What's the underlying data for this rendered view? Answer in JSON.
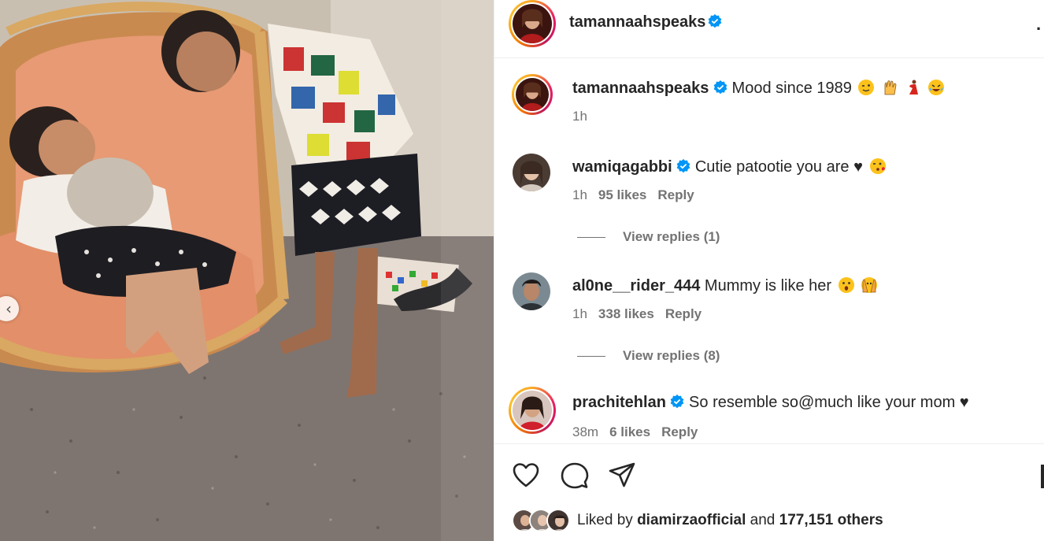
{
  "post": {
    "author": "tamannaahspeaks",
    "caption": {
      "username": "tamannaahspeaks",
      "text": "Mood since 1989",
      "time": "1h",
      "emojis": [
        "winking-face-icon",
        "raised-hands-icon",
        "dancer-icon",
        "rofl-face-icon"
      ]
    }
  },
  "comments": [
    {
      "username": "wamiqagabbi",
      "verified": true,
      "text": "Cutie patootie you are ♥",
      "time": "1h",
      "likes": "95 likes",
      "reply": "Reply",
      "view_replies": "View replies (1)",
      "emoji": "kissing-wink-face-icon"
    },
    {
      "username": "al0ne__rider_444",
      "verified": false,
      "text": "Mummy is like her",
      "time": "1h",
      "likes": "338 likes",
      "reply": "Reply",
      "view_replies": "View replies (8)",
      "emoji": "surprised-face-icon"
    },
    {
      "username": "prachitehlan",
      "verified": true,
      "text": "So resemble so@much like your mom ♥",
      "time": "38m",
      "likes": "6 likes",
      "reply": "Reply"
    }
  ],
  "likes_summary": {
    "prefix": "Liked by",
    "user": "diamirzaofficial",
    "middle": "and",
    "count": "177,151 others"
  },
  "colors": {
    "verified": "#0095f6",
    "secondary_text": "#737373",
    "primary_text": "#262626",
    "divider": "#efefef"
  }
}
